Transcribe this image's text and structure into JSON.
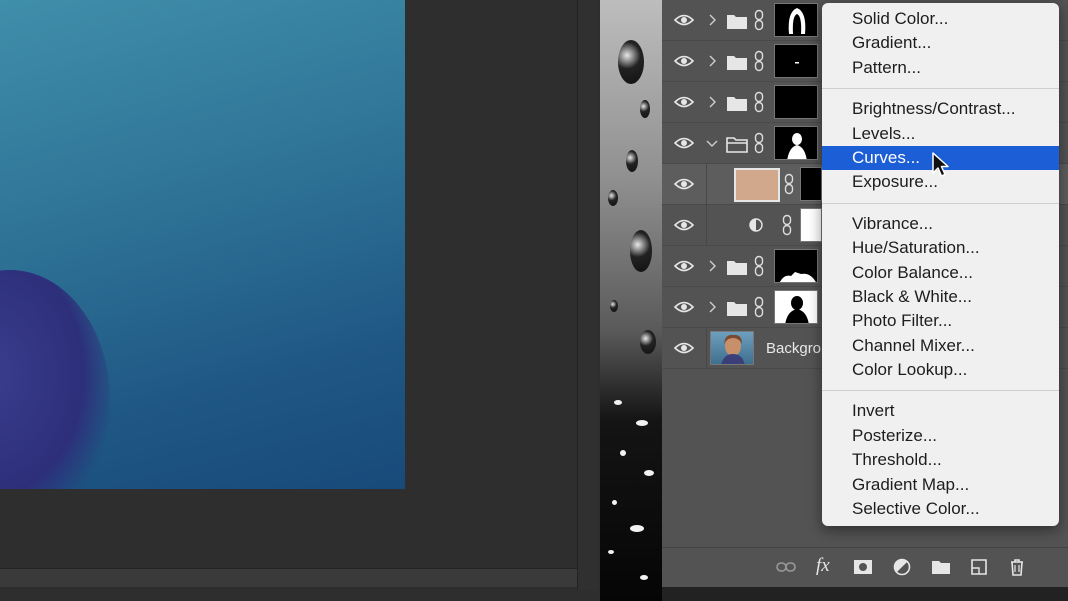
{
  "layers": {
    "rows": [
      {
        "type": "group",
        "thumb": "hair-silhouette"
      },
      {
        "type": "group",
        "thumb": "dash-mask"
      },
      {
        "type": "group",
        "thumb": "black-mask"
      },
      {
        "type": "group-open",
        "thumb": "person-silhouette"
      },
      {
        "type": "fill",
        "swatch_color": "#d2a88c"
      },
      {
        "type": "adjustment"
      },
      {
        "type": "group",
        "thumb": "shoulders-mask"
      },
      {
        "type": "group",
        "thumb": "person-silhouette"
      },
      {
        "type": "background",
        "label": "Backgro"
      }
    ],
    "background_label": "Backgro",
    "footer_icons": [
      "link-icon",
      "fx-icon",
      "add-mask-icon",
      "adjustment-layer-icon",
      "new-group-icon",
      "new-layer-icon",
      "trash-icon"
    ],
    "footer_fx_label": "fx"
  },
  "menu": {
    "sections": [
      [
        "Solid Color...",
        "Gradient...",
        "Pattern..."
      ],
      [
        "Brightness/Contrast...",
        "Levels...",
        "Curves...",
        "Exposure..."
      ],
      [
        "Vibrance...",
        "Hue/Saturation...",
        "Color Balance...",
        "Black & White...",
        "Photo Filter...",
        "Channel Mixer...",
        "Color Lookup..."
      ],
      [
        "Invert",
        "Posterize...",
        "Threshold...",
        "Gradient Map...",
        "Selective Color..."
      ]
    ],
    "highlighted": "Curves...",
    "highlight_color": "#1c5ed6"
  }
}
